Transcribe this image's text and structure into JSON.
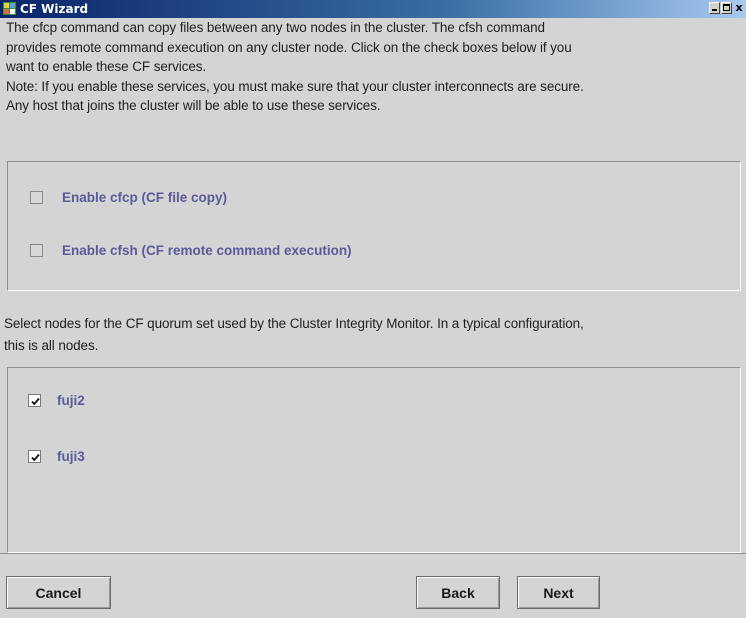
{
  "window": {
    "title": "CF Wizard",
    "title_icon": "cf-wizard-app-icon",
    "controls": {
      "minimize_icon": "minimize-icon",
      "maximize_icon": "maximize-icon",
      "close_glyph": "x"
    }
  },
  "intro": {
    "line1": "The cfcp command can copy files between any two nodes in the cluster.  The cfsh command",
    "line2": "provides remote command execution on any cluster node.  Click on the check boxes below if you",
    "line3": "want to enable these CF services.",
    "line4": "Note: If you enable these services, you must make sure that your cluster interconnects are secure.",
    "line5": "Any host that joins the cluster will be able to use these services."
  },
  "services": {
    "cfcp": {
      "label": "Enable cfcp (CF file copy)",
      "checked": false
    },
    "cfsh": {
      "label": "Enable cfsh (CF remote command execution)",
      "checked": false
    }
  },
  "quorum": {
    "line1": "Select nodes for the CF quorum set used by the Cluster Integrity Monitor.  In a typical configuration,",
    "line2": "this is all nodes.",
    "nodes": [
      {
        "label": "fuji2",
        "checked": true
      },
      {
        "label": "fuji3",
        "checked": true
      }
    ]
  },
  "buttons": {
    "cancel": "Cancel",
    "back": "Back",
    "next": "Next"
  },
  "colors": {
    "checkbox_label": "#5b5a9b",
    "titlebar_start": "#0a246a",
    "window_background": "#d4d4d4"
  }
}
